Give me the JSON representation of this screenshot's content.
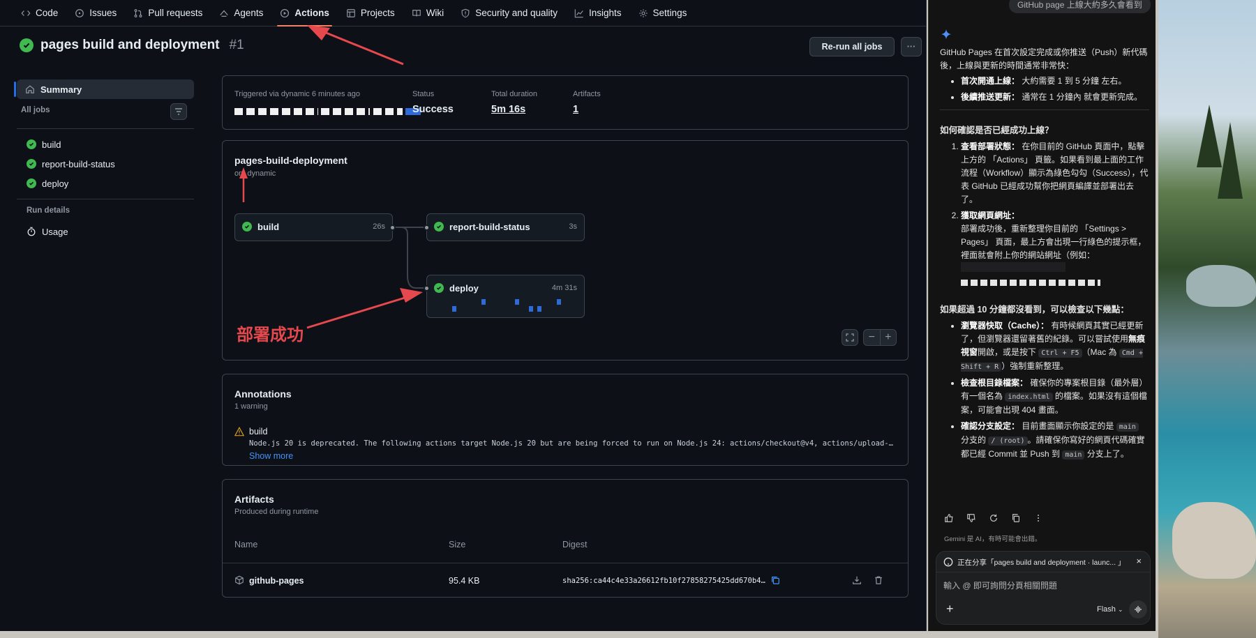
{
  "nav": {
    "tabs": [
      {
        "label": "Code",
        "icon": "code-icon"
      },
      {
        "label": "Issues",
        "icon": "issue-icon"
      },
      {
        "label": "Pull requests",
        "icon": "pull-request-icon"
      },
      {
        "label": "Agents",
        "icon": "agents-icon"
      },
      {
        "label": "Actions",
        "icon": "play-icon",
        "active": true
      },
      {
        "label": "Projects",
        "icon": "table-icon"
      },
      {
        "label": "Wiki",
        "icon": "book-icon"
      },
      {
        "label": "Security and quality",
        "icon": "shield-icon"
      },
      {
        "label": "Insights",
        "icon": "graph-icon"
      },
      {
        "label": "Settings",
        "icon": "gear-icon"
      }
    ]
  },
  "run": {
    "title": "pages build and deployment",
    "number": "#1",
    "rerun_label": "Re-run all jobs",
    "more_label": "···"
  },
  "sidebar": {
    "summary": "Summary",
    "all_jobs": "All jobs",
    "jobs": [
      "build",
      "report-build-status",
      "deploy"
    ],
    "run_details": "Run details",
    "usage": "Usage"
  },
  "summary": {
    "triggered": "Triggered via dynamic 6 minutes ago",
    "status_label": "Status",
    "status_value": "Success",
    "duration_label": "Total duration",
    "duration_value": "5m 16s",
    "artifacts_label": "Artifacts",
    "artifacts_value": "1"
  },
  "workflow": {
    "name": "pages-build-deployment",
    "trigger": "on: dynamic",
    "jobs": [
      {
        "name": "build",
        "time": "26s"
      },
      {
        "name": "report-build-status",
        "time": "3s"
      },
      {
        "name": "deploy",
        "time": "4m 31s"
      }
    ],
    "annotation_text": "部署成功"
  },
  "annotations": {
    "title": "Annotations",
    "count": "1 warning",
    "job": "build",
    "message": "Node.js 20 is deprecated. The following actions target Node.js 20 but are being forced to run on Node.js 24: actions/checkout@v4, actions/upload-…",
    "show_more": "Show more"
  },
  "artifacts": {
    "title": "Artifacts",
    "subtitle": "Produced during runtime",
    "headers": [
      "Name",
      "Size",
      "Digest"
    ],
    "rows": [
      {
        "name": "github-pages",
        "size": "95.4 KB",
        "digest": "sha256:ca44c4e33a26612fb10f27858275425dd670b4…"
      }
    ]
  },
  "gemini": {
    "user_msg": "GitHub page 上線大約多久會看到",
    "intro": "GitHub Pages 在首次設定完成或你推送（Push）新代碼後，上線與更新的時間通常非常快：",
    "bullet1_b": "首次開通上線：",
    "bullet1": " 大約需要 1 到 5 分鐘 左右。",
    "bullet2_b": "後續推送更新：",
    "bullet2": " 通常在 1 分鐘內 就會更新完成。",
    "h1": "如何確認是否已經成功上線？",
    "ol1_b": "查看部署狀態：",
    "ol1": " 在你目前的 GitHub 頁面中，點擊上方的 「Actions」 頁籤。如果看到最上面的工作流程（Workflow）顯示為綠色勾勾（Success），代表 GitHub 已經成功幫你把網頁編譯並部署出去了。",
    "ol2_b": "獲取網頁網址：",
    "ol2": "部署成功後，重新整理你目前的 「Settings > Pages」 頁面，最上方會出現一行綠色的提示框，裡面就會附上你的網站網址（例如：",
    "h2": "如果超過 10 分鐘都沒看到，可以檢查以下幾點：",
    "c1_b": "瀏覽器快取（Cache）：",
    "c1a": " 有時候網頁其實已經更新了，但瀏覽器還留著舊的紀錄。可以嘗試使用",
    "c1_b2": "無痕視窗",
    "c1b": "開啟，或是按下 ",
    "k1": "Ctrl + F5",
    "c1c": "（Mac 為 ",
    "k2": "Cmd + Shift + R",
    "c1d": "）強制重新整理。",
    "c2_b": "檢查根目錄檔案：",
    "c2a": " 確保你的專案根目錄（最外層）有一個名為 ",
    "k3": "index.html",
    "c2b": " 的檔案。如果沒有這個檔案，可能會出現 404 畫面。",
    "c3_b": "確認分支設定：",
    "c3a": " 目前畫面顯示你設定的是 ",
    "k4": "main",
    "c3b": " 分支的 ",
    "k5": "/ (root)",
    "c3c": "。請確保你寫好的網頁代碼確實都已經 Commit 並 Push 到 ",
    "k6": "main",
    "c3d": " 分支上了。",
    "disclaimer": "Gemini 是 AI，有時可能會出錯。",
    "sharing": "正在分享「pages build and deployment · launc... 」",
    "input_placeholder": "輸入 @ 即可詢問分頁相關問題",
    "model": "Flash"
  }
}
